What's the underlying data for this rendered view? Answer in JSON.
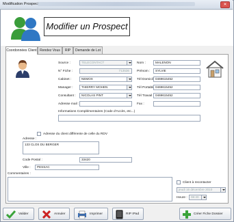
{
  "window": {
    "title": "Modification Prospect"
  },
  "header": {
    "title": "Modifier un Prospect"
  },
  "tabs": [
    {
      "label": "Coordonnées Client"
    },
    {
      "label": "Rendez Vous"
    },
    {
      "label": "RIP"
    },
    {
      "label": "Demande de Lot"
    }
  ],
  "form": {
    "source": {
      "label": "Source :",
      "value": "TELECONTACT"
    },
    "fiche": {
      "label": "N° Fiche :",
      "value": "713536"
    },
    "cabinet": {
      "label": "Cabinet :",
      "value": "NEMOX"
    },
    "manager": {
      "label": "Manager :",
      "value": "THIERRY MOHEN"
    },
    "consultant": {
      "label": "Consultant :",
      "value": "NICOLAS PINT"
    },
    "email": {
      "label": "Adresse mail :",
      "value": ""
    },
    "info": {
      "label": "Informations Complémentaires (Code d'Accès, etc...)",
      "value": ""
    },
    "nom": {
      "label": "Nom :",
      "value": "MALENON"
    },
    "prenom": {
      "label": "Prénom :",
      "value": "SYLVIE"
    },
    "tel_domicile": {
      "label": "Tél Domicile :",
      "value": "0469615452"
    },
    "tel_portable": {
      "label": "Tél Portable :",
      "value": "0469615452"
    },
    "tel_travail": {
      "label": "Tél Travail :",
      "value": "0469615452"
    },
    "fax": {
      "label": "Fax :",
      "value": ""
    },
    "rdv_address": {
      "label": "Adresse du client différente de celle du RDV",
      "checked": false
    },
    "adresse": {
      "label": "Adresse :",
      "value": "133 CLOS DU BERGER"
    },
    "code_postal": {
      "label": "Code Postal :",
      "value": "33420"
    },
    "ville": {
      "label": "Ville :",
      "value": "PESSAC"
    },
    "commentaires": {
      "label": "Commentaires :",
      "value": ""
    },
    "recontacter": {
      "label": "Client à recontacter",
      "checked": false
    },
    "date": {
      "value": "jeudi   16 décembre 2010"
    },
    "heure": {
      "label": "Heure :",
      "value": "08:30"
    }
  },
  "buttons": {
    "valider": "Valider",
    "annuler": "Annuler",
    "imprimer": "Imprimer",
    "rip_ipad": "RIP IPad",
    "creer_fiche": "Créer Fiche Dossier"
  }
}
